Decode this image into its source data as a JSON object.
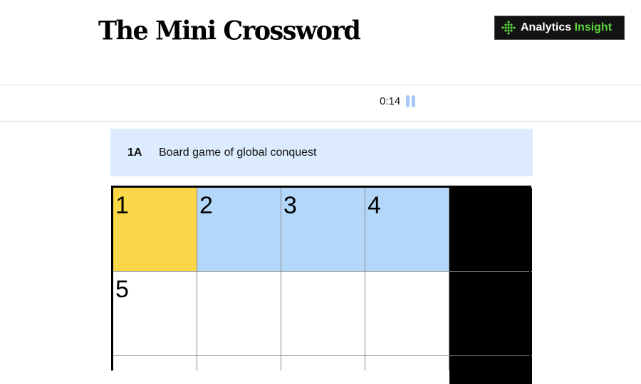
{
  "header": {
    "title": "The Mini Crossword",
    "logo": {
      "name_prefix": "Analytics ",
      "name_accent": "Insight",
      "accent_color": "#5cd83d"
    }
  },
  "toolbar": {
    "timer": "0:14",
    "pause_icon": "pause-icon"
  },
  "clue": {
    "number": "1A",
    "text": "Board game of global conquest"
  },
  "colors": {
    "selected": "#fad748",
    "word_highlight": "#b3d7fb",
    "clue_bar": "#dcebfd"
  },
  "grid": {
    "cells": [
      {
        "num": "1",
        "state": "selected",
        "letter": ""
      },
      {
        "num": "2",
        "state": "word",
        "letter": ""
      },
      {
        "num": "3",
        "state": "word",
        "letter": ""
      },
      {
        "num": "4",
        "state": "word",
        "letter": ""
      },
      {
        "num": "",
        "state": "black",
        "letter": ""
      },
      {
        "num": "5",
        "state": "empty",
        "letter": ""
      },
      {
        "num": "",
        "state": "empty",
        "letter": ""
      },
      {
        "num": "",
        "state": "empty",
        "letter": ""
      },
      {
        "num": "",
        "state": "empty",
        "letter": ""
      },
      {
        "num": "",
        "state": "black",
        "letter": ""
      },
      {
        "num": "",
        "state": "empty",
        "letter": ""
      },
      {
        "num": "",
        "state": "empty",
        "letter": ""
      },
      {
        "num": "",
        "state": "empty",
        "letter": ""
      },
      {
        "num": "",
        "state": "empty",
        "letter": ""
      },
      {
        "num": "",
        "state": "black",
        "letter": ""
      }
    ]
  }
}
